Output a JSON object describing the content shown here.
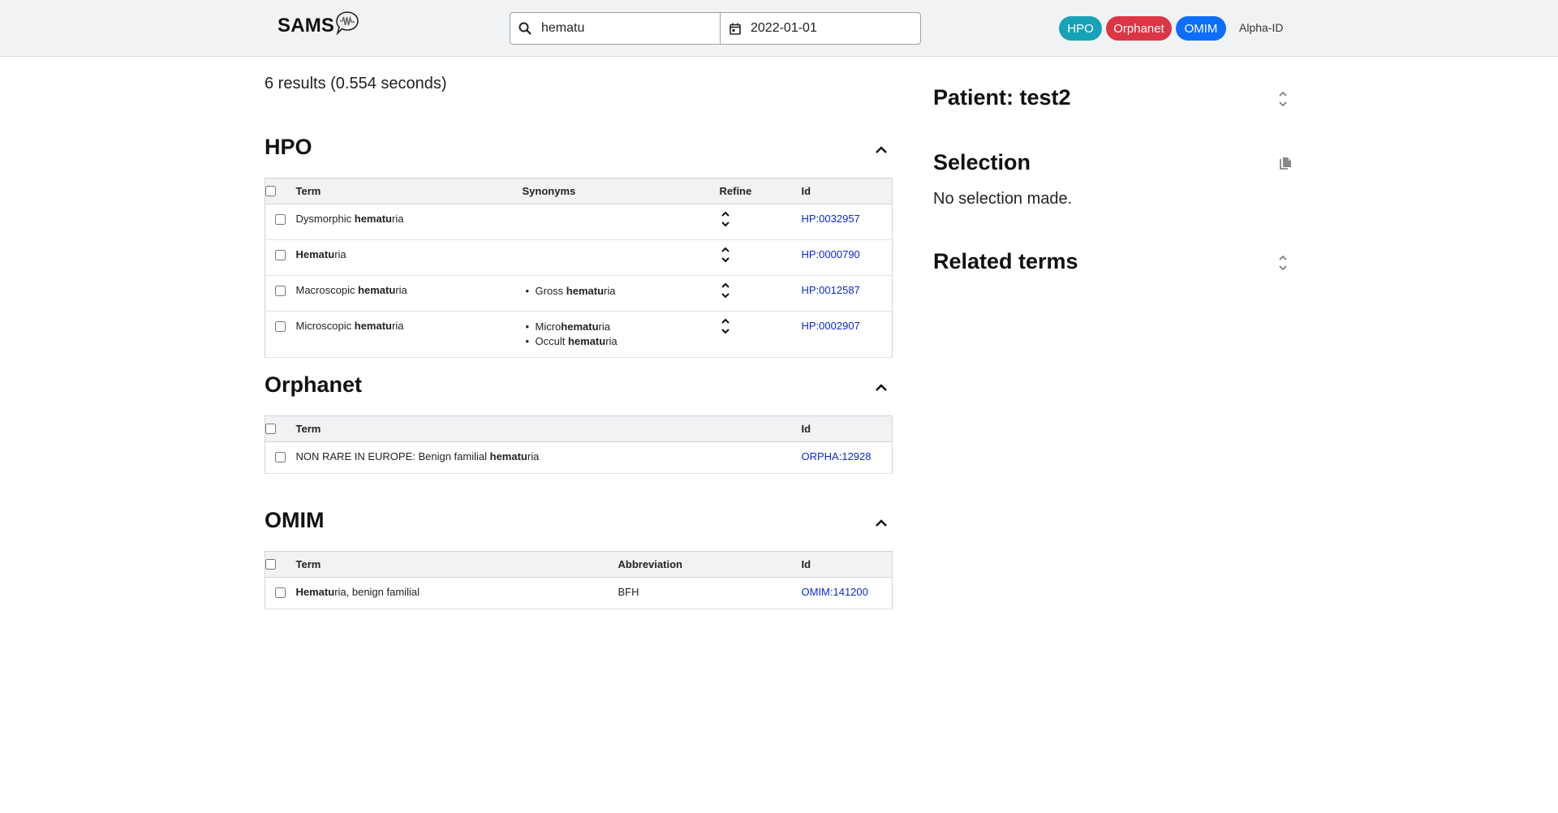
{
  "header": {
    "logo": "SAMS",
    "search": {
      "value": "hematu"
    },
    "date": {
      "value": "2022-01-01"
    },
    "pills": {
      "hpo": "HPO",
      "orphanet": "Orphanet",
      "omim": "OMIM"
    },
    "alpha_link": "Alpha-ID"
  },
  "results_summary": "6 results (0.554 seconds)",
  "hpo": {
    "title": "HPO",
    "columns": {
      "term": "Term",
      "synonyms": "Synonyms",
      "refine": "Refine",
      "id": "Id"
    },
    "rows": [
      {
        "term_pre": "Dysmorphic ",
        "term_bold": "hematu",
        "term_post": "ria",
        "synonyms": [],
        "id": "HP:0032957"
      },
      {
        "term_pre": "",
        "term_bold": "Hematu",
        "term_post": "ria",
        "synonyms": [],
        "id": "HP:0000790"
      },
      {
        "term_pre": "Macroscopic ",
        "term_bold": "hematu",
        "term_post": "ria",
        "synonyms": [
          {
            "pre": "Gross ",
            "bold": "hematu",
            "post": "ria"
          }
        ],
        "id": "HP:0012587"
      },
      {
        "term_pre": "Microscopic ",
        "term_bold": "hematu",
        "term_post": "ria",
        "synonyms": [
          {
            "pre": "Micro",
            "bold": "hematu",
            "post": "ria"
          },
          {
            "pre": "Occult ",
            "bold": "hematu",
            "post": "ria"
          }
        ],
        "id": "HP:0002907"
      }
    ]
  },
  "orphanet": {
    "title": "Orphanet",
    "columns": {
      "term": "Term",
      "id": "Id"
    },
    "rows": [
      {
        "term_pre": "NON RARE IN EUROPE: Benign familial ",
        "term_bold": "hematu",
        "term_post": "ria",
        "id": "ORPHA:12928"
      }
    ]
  },
  "omim": {
    "title": "OMIM",
    "columns": {
      "term": "Term",
      "abbreviation": "Abbreviation",
      "id": "Id"
    },
    "rows": [
      {
        "term_pre": "",
        "term_bold": "Hematu",
        "term_post": "ria, benign familial",
        "abbreviation": "BFH",
        "id": "OMIM:141200"
      }
    ]
  },
  "sidebar": {
    "patient_title": "Patient: test2",
    "selection_title": "Selection",
    "selection_empty": "No selection made.",
    "related_title": "Related terms"
  },
  "colors": {
    "hpo": "#17a2b8",
    "orphanet": "#dc3545",
    "omim": "#0d6efd",
    "link": "#0d28d8"
  }
}
